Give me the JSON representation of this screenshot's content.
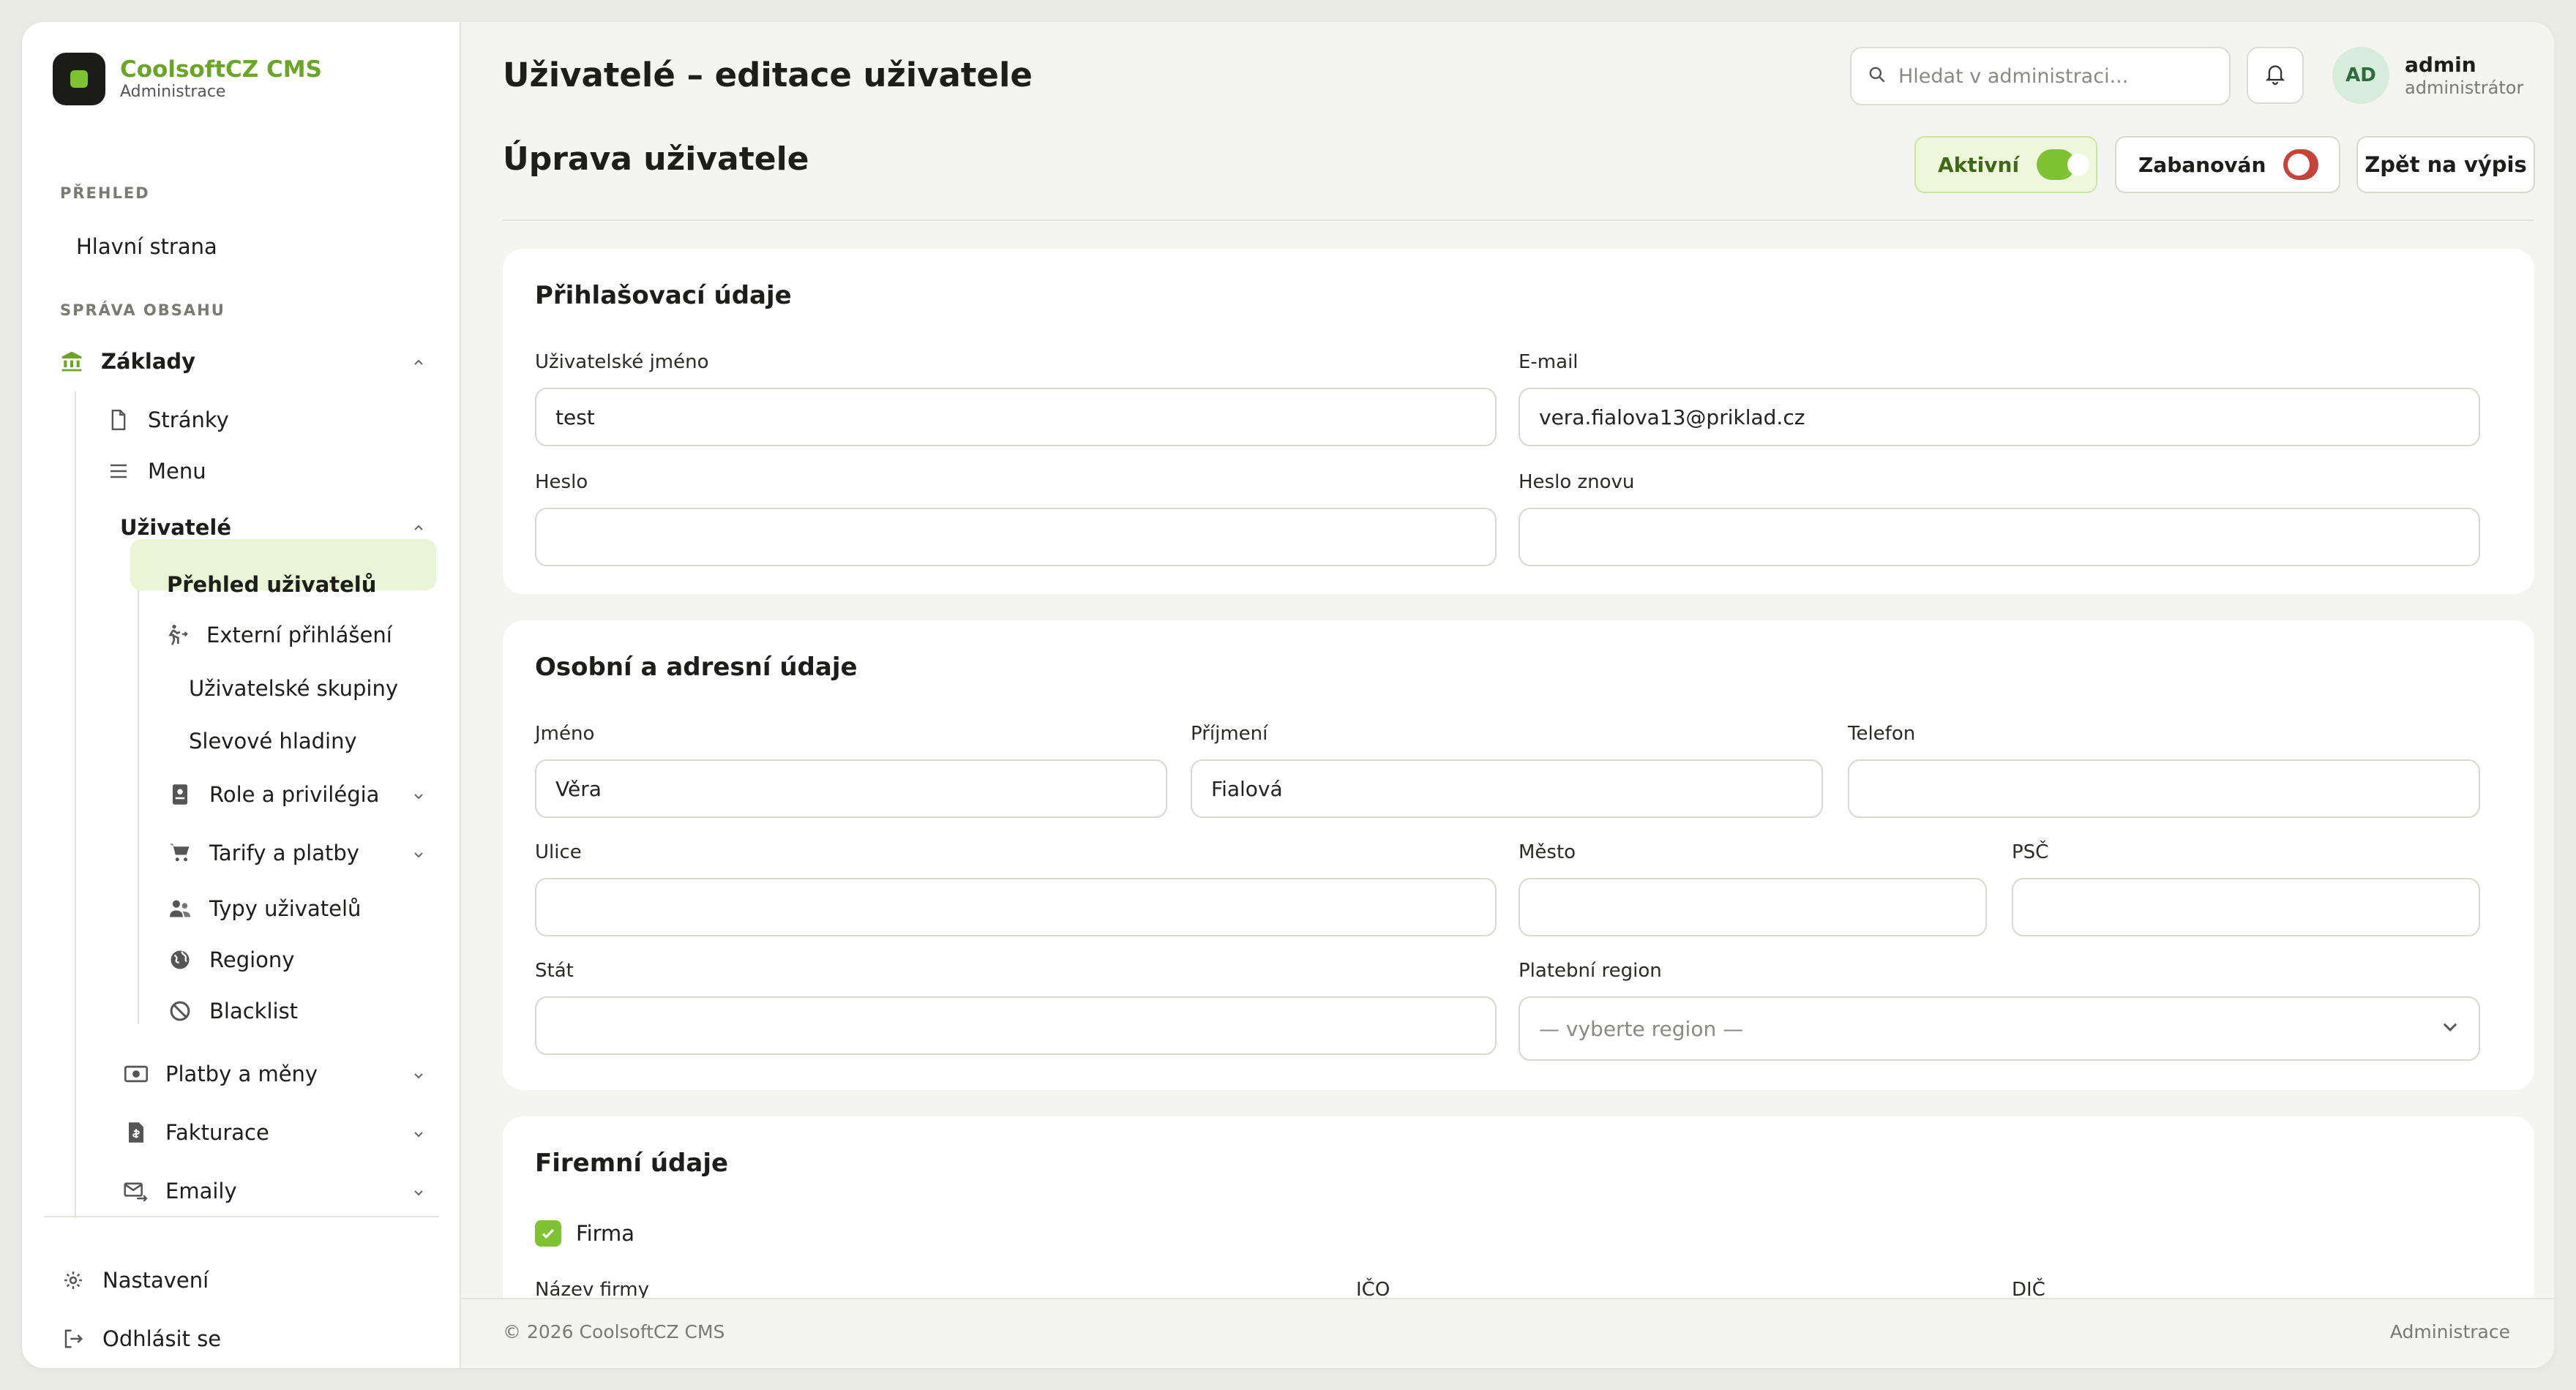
{
  "brand": {
    "name": "CoolsoftCZ CMS",
    "subtitle": "Administrace"
  },
  "sidebar": {
    "sections": [
      {
        "title": "PŘEHLED"
      },
      {
        "title": "SPRÁVA OBSAHU"
      }
    ],
    "home": "Hlavní strana",
    "zaklady": "Základy",
    "stranky": "Stránky",
    "menu": "Menu",
    "uzivatele": "Uživatelé",
    "prehled_uzivatelu": "Přehled uživatelů",
    "externi_prihlaseni": "Externí přihlášení",
    "uzivatelske_skupiny": "Uživatelské skupiny",
    "slevove_hladiny": "Slevové hladiny",
    "role": "Role a privilégia",
    "tarify": "Tarify a platby",
    "typy_uzivatelu": "Typy uživatelů",
    "regiony": "Regiony",
    "blacklist": "Blacklist",
    "platby_meny": "Platby a měny",
    "fakturace": "Fakturace",
    "emaily": "Emaily",
    "nastaveni": "Nastavení",
    "odhlasit": "Odhlásit se"
  },
  "header": {
    "title": "Uživatelé – editace uživatele",
    "search_placeholder": "Hledat v administraci...",
    "user": {
      "initials": "AD",
      "name": "admin",
      "role": "administrátor"
    }
  },
  "page": {
    "title": "Úprava uživatele",
    "active_label": "Aktivní",
    "active_on": true,
    "banned_label": "Zabanován",
    "banned_on": false,
    "back_label": "Zpět na výpis"
  },
  "colors": {
    "accent": "#7fc232",
    "danger": "#c8423a",
    "brand_text": "#6aa626"
  },
  "login": {
    "title": "Přihlašovací údaje",
    "username_label": "Uživatelské jméno",
    "username_value": "test",
    "email_label": "E-mail",
    "email_value": "vera.fialova13@priklad.cz",
    "password_label": "Heslo",
    "password_value": "",
    "password2_label": "Heslo znovu",
    "password2_value": ""
  },
  "personal": {
    "title": "Osobní a adresní údaje",
    "first_label": "Jméno",
    "first_value": "Věra",
    "last_label": "Příjmení",
    "last_value": "Fialová",
    "phone_label": "Telefon",
    "phone_value": "",
    "street_label": "Ulice",
    "street_value": "",
    "city_label": "Město",
    "city_value": "",
    "zip_label": "PSČ",
    "zip_value": "",
    "country_label": "Stát",
    "country_value": "",
    "region_label": "Platební region",
    "region_value": "— vyberte region —"
  },
  "company": {
    "title": "Firemní údaje",
    "firma_label": "Firma",
    "firma_checked": true,
    "name_label": "Název firmy",
    "ico_label": "IČO",
    "dic_label": "DIČ"
  },
  "footer": {
    "copyright": "© 2026 CoolsoftCZ CMS",
    "right": "Administrace"
  }
}
